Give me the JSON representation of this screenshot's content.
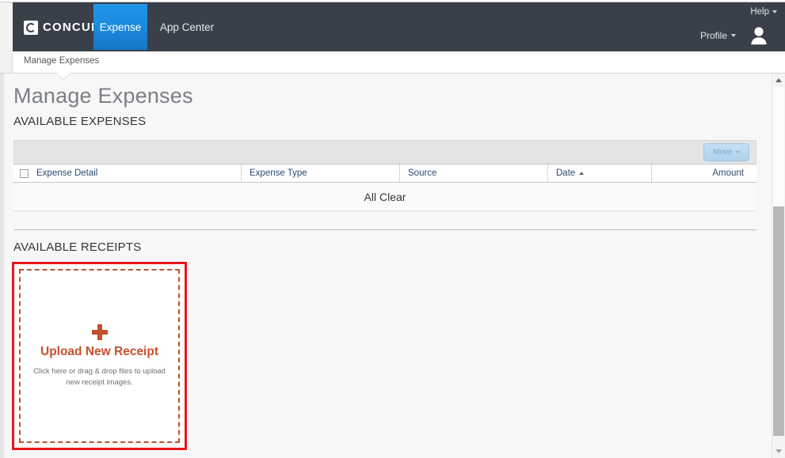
{
  "header": {
    "logo_text": "CONCUR",
    "logo_icon": "concur-c-logo-icon",
    "tabs": [
      {
        "label": "Expense",
        "active": true
      },
      {
        "label": "App Center",
        "active": false
      }
    ],
    "help_label": "Help",
    "profile_label": "Profile",
    "avatar_icon": "user-avatar-icon",
    "caret_icon": "chevron-down-icon",
    "nav_bg": "#39404a",
    "active_tab_color": "#1b8ade"
  },
  "subnav": {
    "items": [
      {
        "label": "Manage Expenses"
      }
    ]
  },
  "page": {
    "title": "Manage Expenses",
    "sections": {
      "available_expenses": "AVAILABLE EXPENSES",
      "available_receipts": "AVAILABLE RECEIPTS"
    }
  },
  "expenses_grid": {
    "toolbar": {
      "move_label": "Move",
      "move_caret_icon": "chevron-down-icon",
      "move_disabled": true
    },
    "select_all_checkbox": {
      "name": "select-all-checkbox",
      "checked": false
    },
    "columns": [
      {
        "label": "Expense Detail",
        "align": "left",
        "sorted": false
      },
      {
        "label": "Expense Type",
        "align": "left",
        "sorted": false
      },
      {
        "label": "Source",
        "align": "left",
        "sorted": false
      },
      {
        "label": "Date",
        "align": "left",
        "sorted": true,
        "sort_direction": "asc",
        "sort_icon": "sort-ascending-icon"
      },
      {
        "label": "Amount",
        "align": "right",
        "sorted": false
      }
    ],
    "rows": [],
    "empty_message": "All Clear"
  },
  "receipts": {
    "upload_tile": {
      "plus_icon": "plus-icon",
      "title": "Upload New Receipt",
      "subtitle": "Click here or drag & drop files to upload new receipt images.",
      "accent_color": "#c4502d",
      "highlight_color": "#e8161a",
      "highlighted": true
    }
  },
  "scrollbar": {
    "up_arrow_icon": "scroll-up-arrow-icon",
    "down_arrow_icon": "scroll-down-arrow-icon",
    "thumb_name": "scrollbar-thumb"
  }
}
